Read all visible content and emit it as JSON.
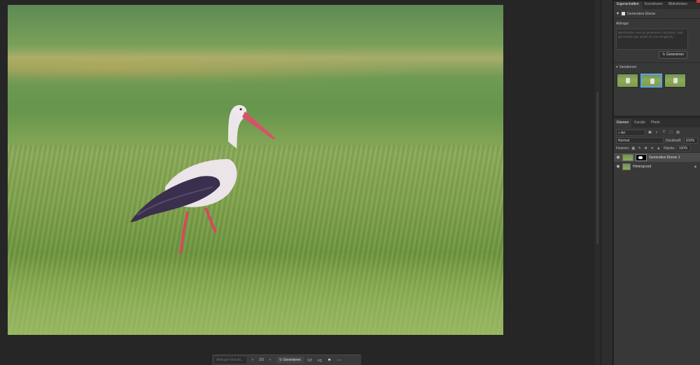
{
  "taskbar": {
    "prompt_placeholder": "Abfrage hinzufü...",
    "count": "2/3",
    "generate_label": "Generieren",
    "prev_icon": "chevron-left-icon",
    "next_icon": "chevron-right-icon"
  },
  "properties": {
    "tabs": [
      "Eigenschaften",
      "Korrekturen",
      "Bibliotheken"
    ],
    "layer_type": "Generative Ebene",
    "prompt_label": "Abfrage:",
    "prompt_placeholder": "Beschreibe, was du generieren möchtest, oder gib einfach gar nichts ein (nur Englisch)",
    "generate_label": "Generieren",
    "variations_label": "Variationen"
  },
  "layers": {
    "tabs": [
      "Ebenen",
      "Kanäle",
      "Pfade"
    ],
    "filter_value": "Art",
    "blend_mode": "Normal",
    "opacity_label": "Deckkraft:",
    "opacity_value": "100%",
    "lock_label": "Fixieren:",
    "fill_label": "Fläche:",
    "fill_value": "100%",
    "items": [
      {
        "name": "Generative Ebene 1"
      },
      {
        "name": "Hintergrund"
      }
    ]
  }
}
